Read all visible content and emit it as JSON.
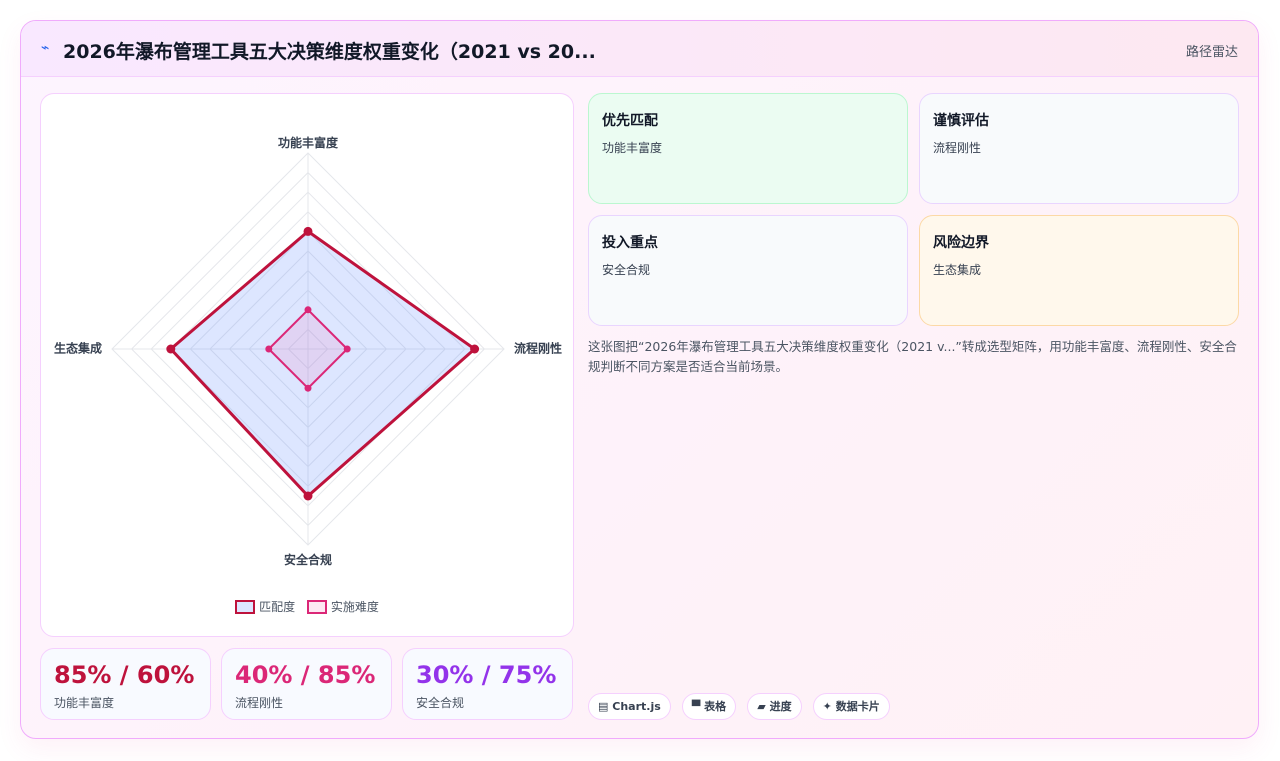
{
  "header": {
    "icon": "trend-line-icon",
    "title": "2026年瀑布管理工具五大决策维度权重变化（2021 vs 20...",
    "link": "路径雷达"
  },
  "chart_data": {
    "type": "radar",
    "axes": [
      "功能丰富度",
      "流程刚性",
      "安全合规",
      "生态集成"
    ],
    "range": [
      0,
      100
    ],
    "grid_levels": 10,
    "series": [
      {
        "name": "匹配度",
        "values": [
          60,
          85,
          75,
          70
        ],
        "stroke": "#be123c",
        "fill": "rgba(99,140,255,0.22)"
      },
      {
        "name": "实施难度",
        "values": [
          20,
          20,
          20,
          20
        ],
        "stroke": "#db2777",
        "fill": "rgba(244,114,182,0.16)"
      }
    ],
    "legend_position": "bottom"
  },
  "stats": [
    {
      "value": "85% / 60%",
      "label": "功能丰富度",
      "color": "#be123c"
    },
    {
      "value": "40% / 85%",
      "label": "流程刚性",
      "color": "#db2777"
    },
    {
      "value": "30% / 75%",
      "label": "安全合规",
      "color": "#9333ea"
    }
  ],
  "quadrants": [
    {
      "title": "优先匹配",
      "value": "功能丰富度",
      "bg": "#ebfcf2",
      "border": "#bbf7d0"
    },
    {
      "title": "谨慎评估",
      "value": "流程刚性",
      "bg": "#f8fafc",
      "border": "#e9d5ff"
    },
    {
      "title": "投入重点",
      "value": "安全合规",
      "bg": "#f8fafc",
      "border": "#e9d5ff"
    },
    {
      "title": "风险边界",
      "value": "生态集成",
      "bg": "#fff8ec",
      "border": "#fcd9a6"
    }
  ],
  "description": "这张图把“2026年瀑布管理工具五大决策维度权重变化（2021 v...”转成选型矩阵，用功能丰富度、流程刚性、安全合规判断不同方案是否适合当前场景。",
  "tags": [
    {
      "icon": "▤",
      "label": "Chart.js"
    },
    {
      "icon": "▀",
      "label": "表格"
    },
    {
      "icon": "▰",
      "label": "进度"
    },
    {
      "icon": "✦",
      "label": "数据卡片"
    }
  ]
}
